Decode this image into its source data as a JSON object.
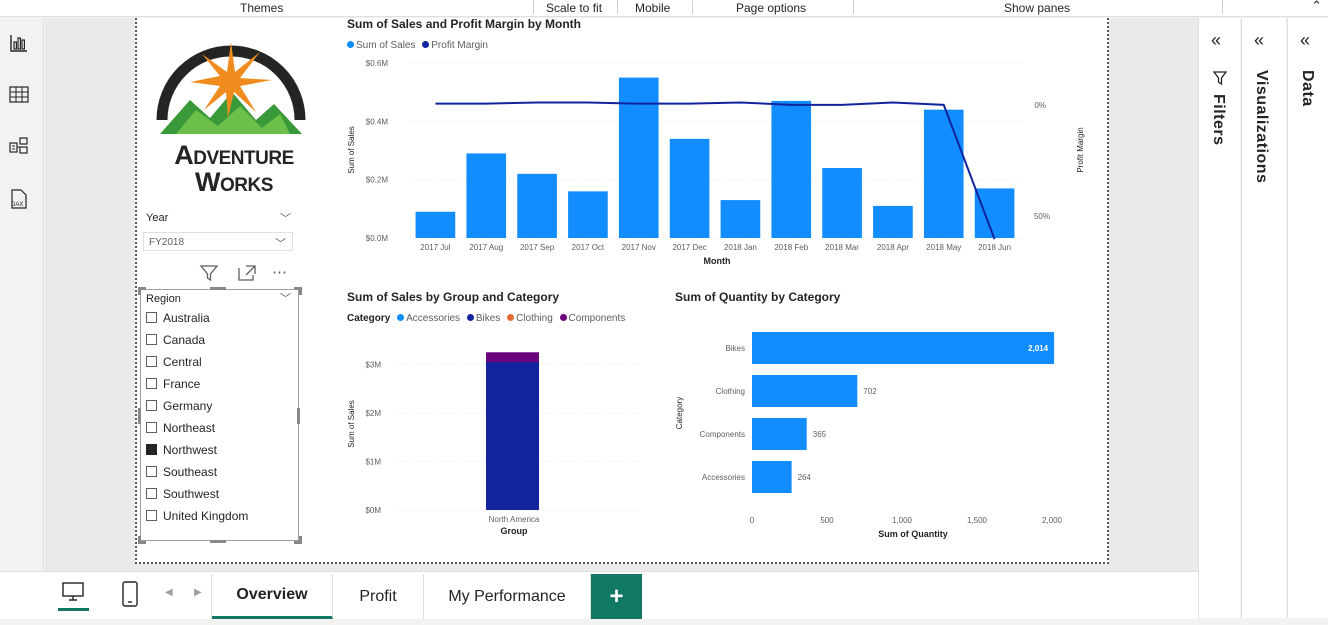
{
  "ribbon": {
    "themes": "Themes",
    "scale_to_fit": "Scale to fit",
    "mobile": "Mobile",
    "page_options": "Page options",
    "show_panes": "Show panes"
  },
  "logo": {
    "line1": "Adventure",
    "line2": "Works"
  },
  "year_slicer": {
    "title": "Year",
    "selected": "FY2018"
  },
  "region_slicer": {
    "title": "Region",
    "items": [
      {
        "label": "Australia",
        "checked": false
      },
      {
        "label": "Canada",
        "checked": false
      },
      {
        "label": "Central",
        "checked": false
      },
      {
        "label": "France",
        "checked": false
      },
      {
        "label": "Germany",
        "checked": false
      },
      {
        "label": "Northeast",
        "checked": false
      },
      {
        "label": "Northwest",
        "checked": true
      },
      {
        "label": "Southeast",
        "checked": false
      },
      {
        "label": "Southwest",
        "checked": false
      },
      {
        "label": "United Kingdom",
        "checked": false
      }
    ]
  },
  "colors": {
    "sales": "#118dff",
    "margin": "#12239e",
    "accessories": "#118dff",
    "bikes": "#12239e",
    "clothing": "#e66c37",
    "components": "#6b007b",
    "accent": "#117865"
  },
  "chart_data": [
    {
      "type": "bar",
      "title": "Sum of Sales and Profit Margin by Month",
      "categories": [
        "2017 Jul",
        "2017 Aug",
        "2017 Sep",
        "2017 Oct",
        "2017 Nov",
        "2017 Dec",
        "2018 Jan",
        "2018 Feb",
        "2018 Mar",
        "2018 Apr",
        "2018 May",
        "2018 Jun"
      ],
      "series": [
        {
          "name": "Sum of Sales",
          "values": [
            0.09,
            0.29,
            0.22,
            0.16,
            0.55,
            0.34,
            0.13,
            0.47,
            0.24,
            0.11,
            0.44,
            0.17
          ]
        },
        {
          "name": "Profit Margin",
          "axis": "secondary",
          "values": [
            0.04,
            0.04,
            0.035,
            0.035,
            0.04,
            0.04,
            0.035,
            0.045,
            0.045,
            0.035,
            0.045,
            0.6
          ]
        }
      ],
      "xlabel": "Month",
      "ylabel": "Sum of Sales",
      "y2label": "Profit Margin",
      "ylim": [
        0,
        0.6
      ],
      "yticks": [
        "$0.0M",
        "$0.2M",
        "$0.4M",
        "$0.6M"
      ],
      "y2ticks": [
        "0%",
        "50%"
      ],
      "legend": "top-left"
    },
    {
      "type": "bar",
      "title": "Sum of Sales by Group and Category",
      "legend_title": "Category",
      "categories": [
        "North America"
      ],
      "series": [
        {
          "name": "Accessories",
          "values": [
            0
          ]
        },
        {
          "name": "Bikes",
          "values": [
            3.05
          ]
        },
        {
          "name": "Clothing",
          "values": [
            0
          ]
        },
        {
          "name": "Components",
          "values": [
            0.2
          ]
        }
      ],
      "xlabel": "Group",
      "ylabel": "Sum of Sales",
      "ylim": [
        0,
        3.4
      ],
      "yticks": [
        "$0M",
        "$1M",
        "$2M",
        "$3M"
      ],
      "legend": "top-left"
    },
    {
      "type": "bar",
      "orientation": "horizontal",
      "title": "Sum of Quantity by Category",
      "categories": [
        "Bikes",
        "Clothing",
        "Components",
        "Accessories"
      ],
      "values": [
        2014,
        702,
        365,
        264
      ],
      "data_labels": [
        "2,014",
        "702",
        "365",
        "264"
      ],
      "xlabel": "Sum of Quantity",
      "ylabel": "Category",
      "xlim": [
        0,
        2000
      ],
      "xticks": [
        "0",
        "500",
        "1,000",
        "1,500",
        "2,000"
      ]
    }
  ],
  "panes": {
    "filters": "Filters",
    "visualizations": "Visualizations",
    "data": "Data"
  },
  "tabs": [
    {
      "label": "Overview",
      "active": true
    },
    {
      "label": "Profit",
      "active": false
    },
    {
      "label": "My Performance",
      "active": false
    }
  ],
  "add_tab_label": "+"
}
